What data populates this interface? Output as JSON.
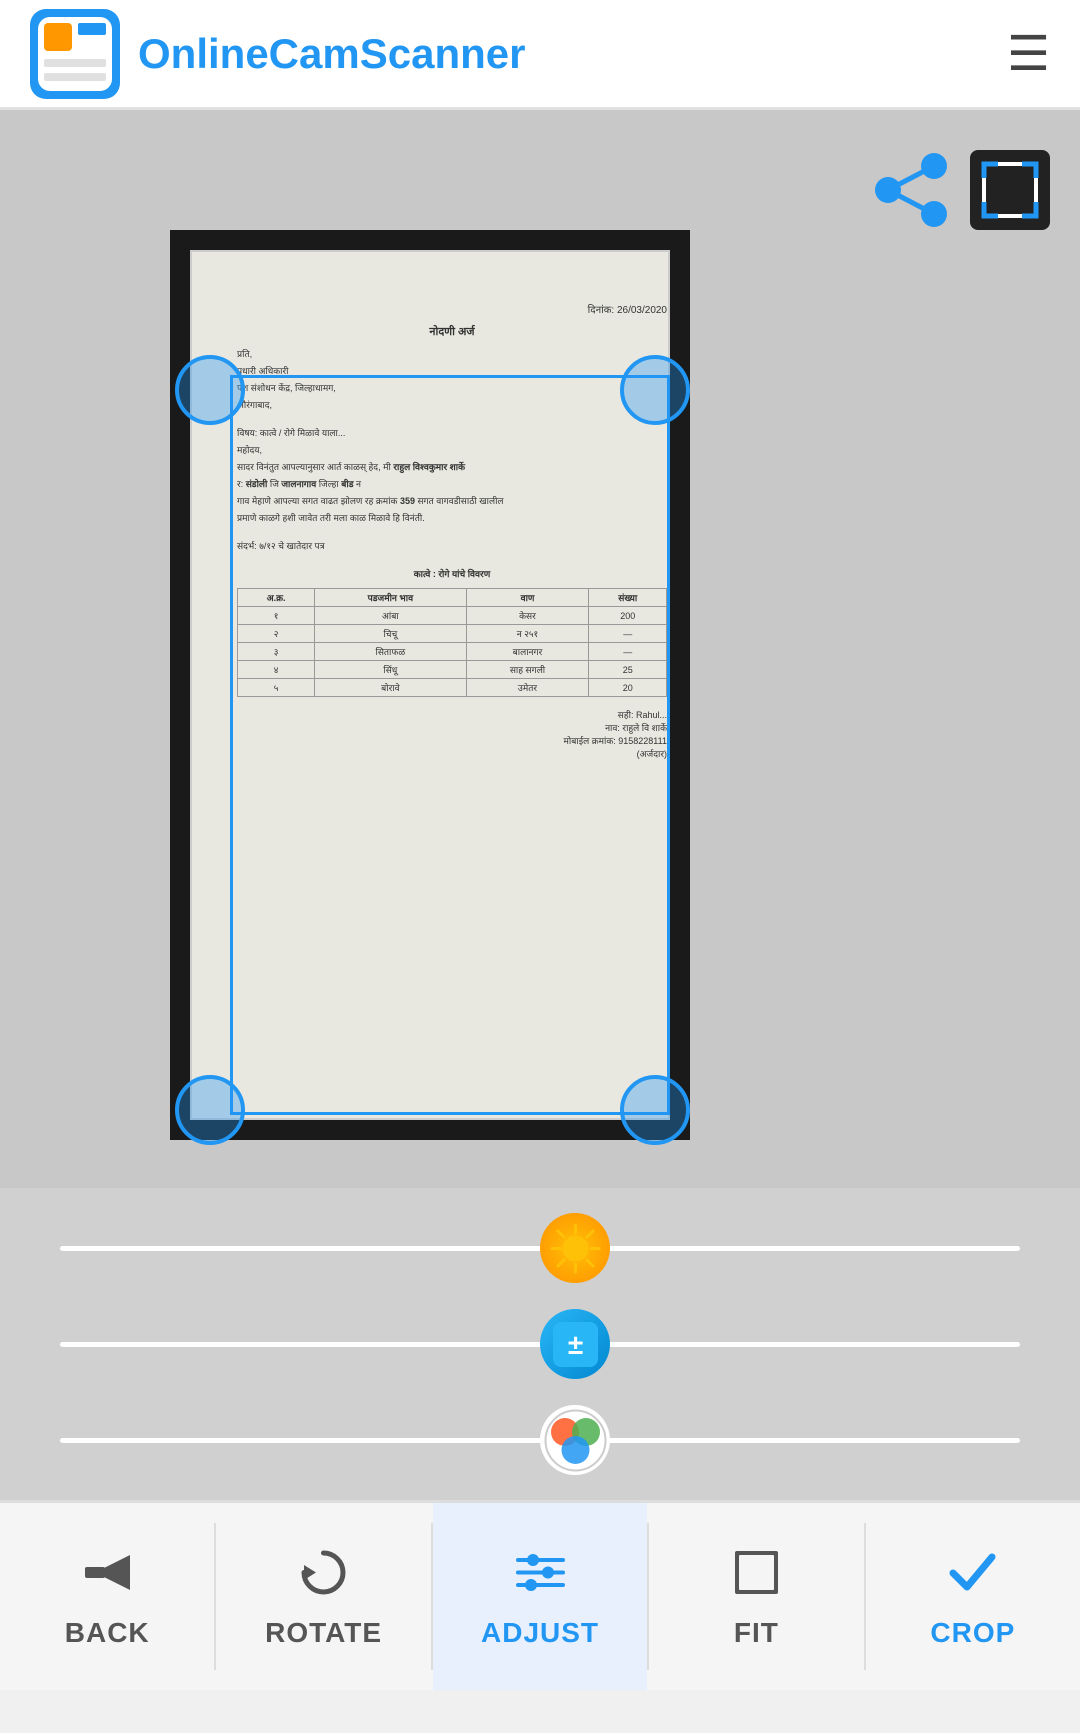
{
  "header": {
    "logo_text": "OnlineCamScanner",
    "hamburger_label": "☰"
  },
  "toolbar": {
    "items": [
      {
        "id": "back",
        "label": "BACK",
        "icon": "←",
        "active": false
      },
      {
        "id": "rotate",
        "label": "ROTATE",
        "icon": "↻",
        "active": false
      },
      {
        "id": "adjust",
        "label": "ADJUST",
        "icon": "⊟",
        "active": true
      },
      {
        "id": "fit",
        "label": "FIT",
        "icon": "⤢",
        "active": false
      },
      {
        "id": "crop",
        "label": "CROP",
        "icon": "✓",
        "active": true
      }
    ]
  },
  "sliders": [
    {
      "id": "brightness",
      "icon": "☀",
      "icon_color": "#FFC107"
    },
    {
      "id": "exposure",
      "icon": "⊞",
      "icon_color": "#29B6F6"
    },
    {
      "id": "color",
      "icon": "◉",
      "icon_color": "#E91E63"
    }
  ],
  "document": {
    "date": "दिनांक: 26/03/2020",
    "title": "नोदणी अर्ज",
    "content": "प्रति,\nप्रधारी अधिकारी\nपश संशोधन केंद्र, जिल्हाधामग,\nऔरंगाबाद,\n\nविषय: कात्वे / रोगे मिळावे याला...\nमहोदय,\nसादर विनंतुत आपल्यानुसार आर्त काळस् हेद, मी राहुल विश्वकुमार शार्के\nर: संडोली जि जालनागाव जिल्हा बीड न\nगाव मेहाणे आपल्या सगत वाढत झोलण रह क्रमांक 359 सगत वागवडीसाठी खालील\nप्रमाणे काळगे हशी जावेत तरी मला काळ मिळावे हि विनंती."
  },
  "icons": {
    "share": "share-icon",
    "fullscreen": "fullscreen-icon",
    "hamburger": "menu-icon"
  },
  "colors": {
    "primary": "#2196F3",
    "accent": "#FF9800",
    "active_bg": "#e8f0fe",
    "toolbar_bg": "#f5f5f5",
    "slider_bg": "#d0d0d0"
  }
}
